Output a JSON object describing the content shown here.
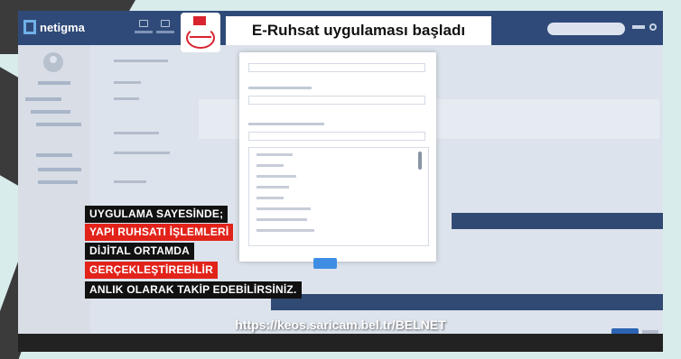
{
  "app": {
    "logo_text": "netigma"
  },
  "headline": "E-Ruhsat uygulaması başladı",
  "captions": [
    {
      "text": "UYGULAMA SAYESİNDE;",
      "style": "black"
    },
    {
      "text": "YAPI RUHSATI İŞLEMLERİ",
      "style": "red"
    },
    {
      "text": "DİJİTAL ORTAMDA",
      "style": "black"
    },
    {
      "text": "GERÇEKLEŞTİREBİLİR",
      "style": "red"
    },
    {
      "text": "ANLIK OLARAK TAKİP EDEBİLİRSİNİZ.",
      "style": "black"
    }
  ],
  "url": "https://keos.saricam.bel.tr/BELNET",
  "colors": {
    "caption_red": "#e2231a",
    "caption_black": "#111111",
    "app_header": "#2f4a78",
    "background": "#d9ecec"
  }
}
